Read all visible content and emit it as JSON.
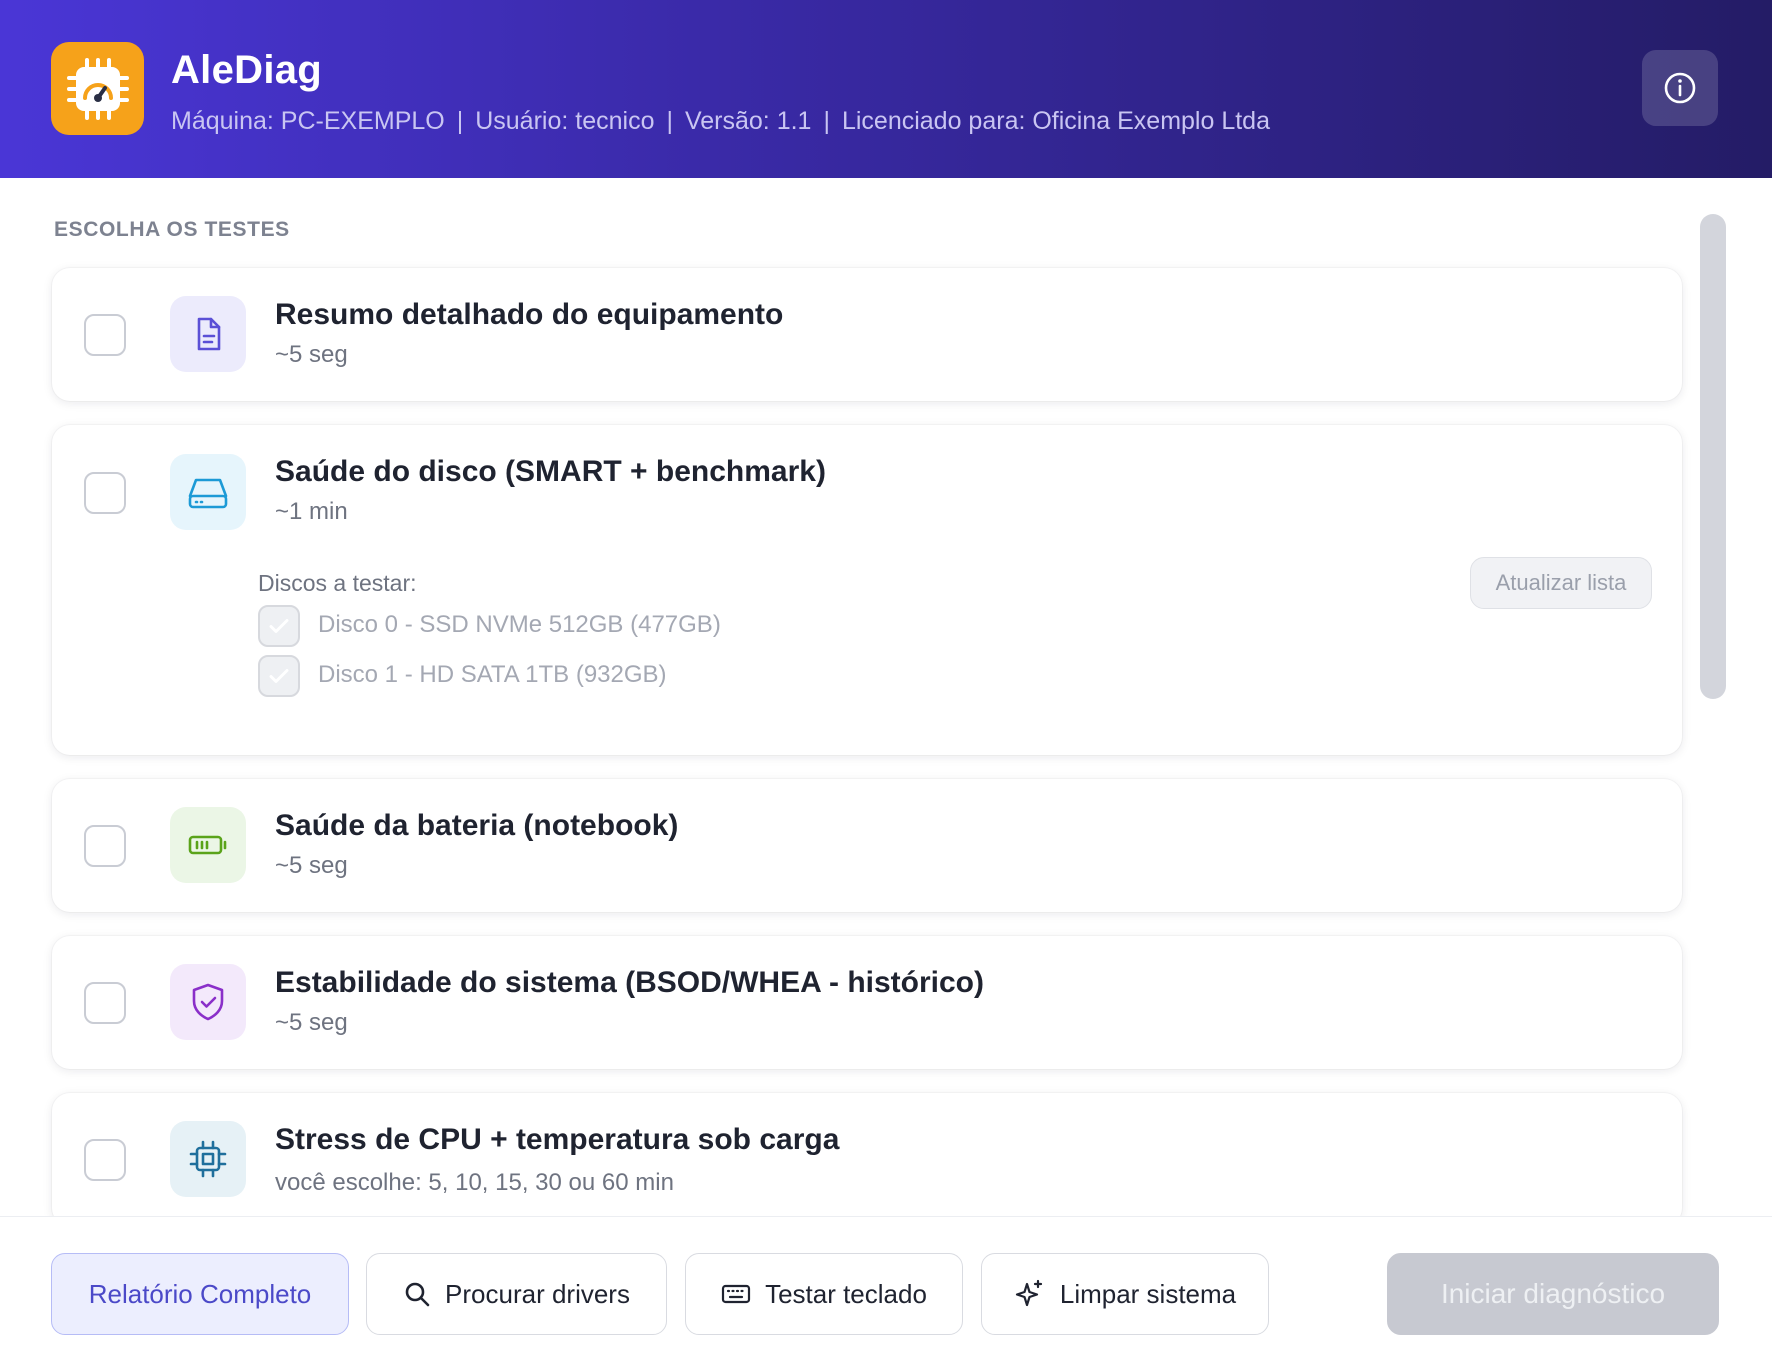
{
  "header": {
    "title": "AleDiag",
    "machine": "Máquina: PC-EXEMPLO",
    "user": "Usuário: tecnico",
    "version": "Versão: 1.1",
    "license": "Licenciado para: Oficina Exemplo Ltda",
    "separator": "|",
    "logo_icon": "cpu-gauge-icon",
    "info_icon": "info-icon"
  },
  "main": {
    "section_title": "ESCOLHA OS TESTES",
    "tests": [
      {
        "title": "Resumo detalhado do equipamento",
        "time": "~5 seg",
        "icon": "document-icon",
        "checked": false
      },
      {
        "title": "Saúde do disco (SMART + benchmark)",
        "time": "~1 min",
        "icon": "hard-drive-icon",
        "checked": false,
        "disks_label": "Discos a testar:",
        "refresh_label": "Atualizar lista",
        "disks": [
          {
            "label": "Disco 0 - SSD NVMe 512GB (477GB)",
            "checked": true
          },
          {
            "label": "Disco 1 - HD SATA 1TB (932GB)",
            "checked": true
          }
        ]
      },
      {
        "title": "Saúde da bateria (notebook)",
        "time": "~5 seg",
        "icon": "battery-icon",
        "checked": false
      },
      {
        "title": "Estabilidade do sistema (BSOD/WHEA - histórico)",
        "time": "~5 seg",
        "icon": "shield-check-icon",
        "checked": false
      },
      {
        "title": "Stress de CPU + temperatura sob carga",
        "time": "você escolhe: 5, 10, 15, 30 ou 60 min",
        "icon": "cpu-icon",
        "checked": false
      }
    ]
  },
  "footer": {
    "report_label": "Relatório Completo",
    "drivers_label": "Procurar drivers",
    "keyboard_label": "Testar teclado",
    "clean_label": "Limpar sistema",
    "start_label": "Iniciar diagnóstico"
  },
  "colors": {
    "header_gradient_start": "#4a36d6",
    "header_gradient_end": "#241c66",
    "logo_bg": "#f6a21a",
    "accent": "#4b49c8",
    "start_disabled": "#c7c9d1"
  }
}
